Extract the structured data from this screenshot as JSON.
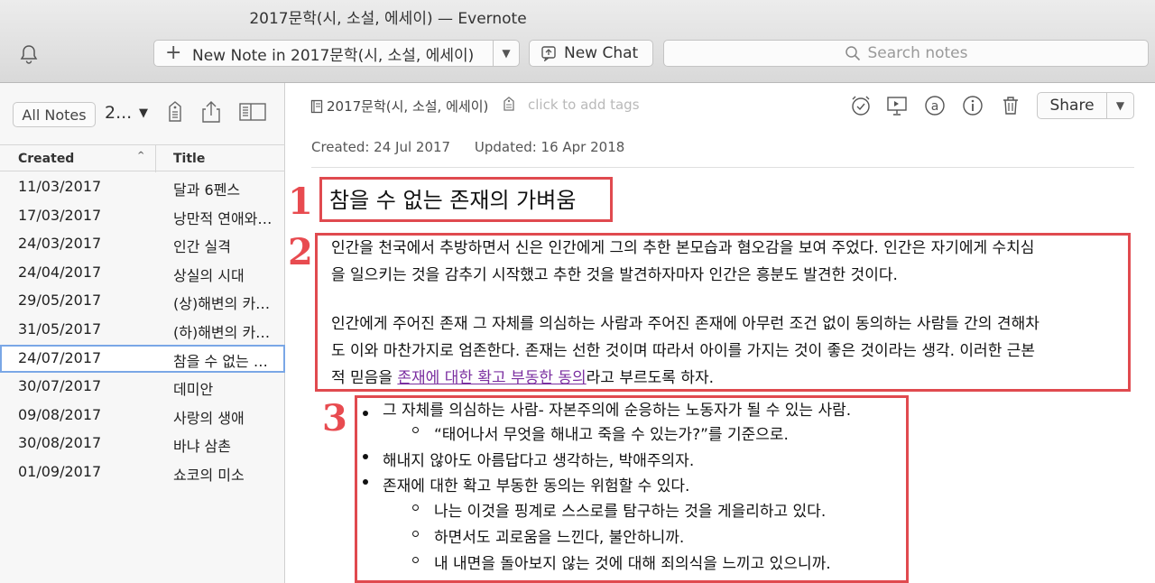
{
  "window": {
    "title": "2017문학(시, 소설, 에세이) — Evernote"
  },
  "toolbar": {
    "new_note_label": "New Note in 2017문학(시, 소설, 에세이)",
    "new_chat_label": "New Chat",
    "search_placeholder": "Search notes"
  },
  "left_panel": {
    "all_notes_label": "All Notes",
    "notebook_short": "2...",
    "columns": {
      "created": "Created",
      "title": "Title"
    },
    "rows": [
      {
        "date": "11/03/2017",
        "title": "달과 6펜스"
      },
      {
        "date": "17/03/2017",
        "title": "낭만적 연애와 그 후의 일상"
      },
      {
        "date": "24/03/2017",
        "title": "인간 실격"
      },
      {
        "date": "24/04/2017",
        "title": "상실의 시대"
      },
      {
        "date": "29/05/2017",
        "title": "(상)해변의 카프카"
      },
      {
        "date": "31/05/2017",
        "title": "(하)해변의 카프카"
      },
      {
        "date": "24/07/2017",
        "title": "참을 수 없는 존재의 가벼움",
        "selected": true
      },
      {
        "date": "30/07/2017",
        "title": "데미안"
      },
      {
        "date": "09/08/2017",
        "title": "사랑의 생애"
      },
      {
        "date": "30/08/2017",
        "title": "바냐 삼촌"
      },
      {
        "date": "01/09/2017",
        "title": "쇼코의 미소"
      }
    ]
  },
  "note": {
    "notebook": "2017문학(시, 소설, 에세이)",
    "tags_placeholder": "click to add tags",
    "share_label": "Share",
    "created": "Created: 24 Jul 2017",
    "updated": "Updated: 16 Apr 2018",
    "title": "참을 수 없는 존재의 가벼움",
    "para1_line1": "인간을 천국에서 추방하면서 신은 인간에게 그의 추한 본모습과 혐오감을 보여 주었다. 인간은 자기에게 수치심",
    "para1_line2": "을 일으키는 것을 감추기 시작했고 추한 것을 발견하자마자 인간은 흥분도 발견한 것이다.",
    "para2_line1": "인간에게 주어진 존재 그 자체를 의심하는 사람과 주어진 존재에 아무런 조건 없이 동의하는 사람들 간의 견해차",
    "para2_line2": "도 이와 마찬가지로 엄존한다. 존재는 선한 것이며 따라서 아이를 가지는 것이 좋은 것이라는 생각. 이러한 근본",
    "para2_line3_a": "적 믿음을 ",
    "para2_line3_link": "존재에 대한 확고 부동한 동의",
    "para2_line3_b": "라고 부르도록 하자.",
    "bullets": [
      "그 자체를 의심하는 사람- 자본주의에 순응하는 노동자가 될 수 있는 사람.",
      "“태어나서 무엇을 해내고 죽을 수 있는가?”를 기준으로.",
      "해내지 않아도 아름답다고 생각하는, 박애주의자.",
      "존재에 대한 확고 부동한 동의는 위험할 수 있다.",
      "나는 이것을 핑계로 스스로를 탐구하는 것을 게을리하고 있다.",
      "하면서도 괴로움을 느낀다, 불안하니까.",
      "내 내면을 돌아보지 않는 것에 대해 죄의식을 느끼고 있으니까."
    ]
  },
  "annotations": {
    "n1": "1",
    "n2": "2",
    "n3": "3"
  },
  "colors": {
    "annotation_red": "#e04a4f",
    "link_purple": "#7b2fa0",
    "selection_blue": "#7aa7e6"
  }
}
